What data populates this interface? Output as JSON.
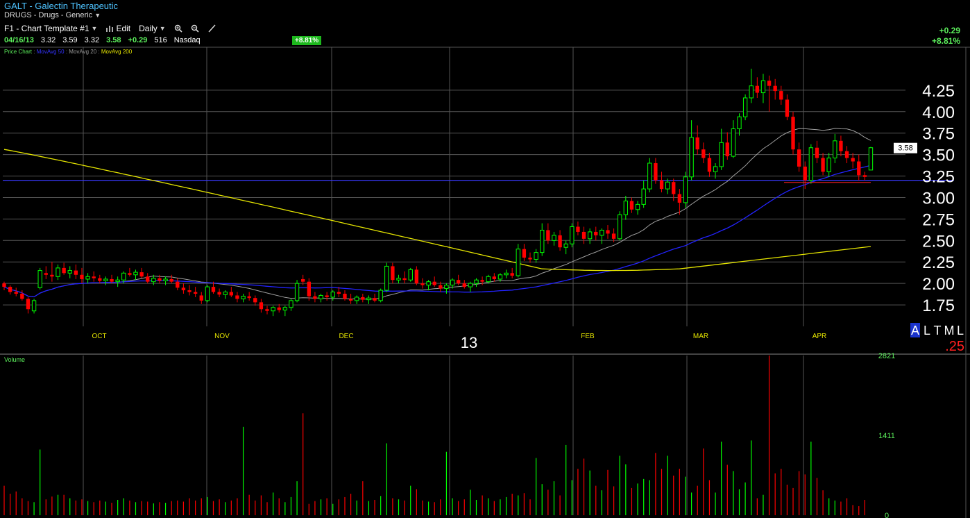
{
  "header": {
    "title": "GALT - Galectin Therapeutic",
    "subtitle": "DRUGS - Drugs - Generic",
    "template": "F1 - Chart Template #1",
    "edit": "Edit",
    "period": "Daily"
  },
  "quote": {
    "date": "04/16/13",
    "open": "3.32",
    "high": "3.59",
    "low": "3.32",
    "last": "3.58",
    "change": "+0.29",
    "volume": "516",
    "exchange": "Nasdaq",
    "pct_box": "+8.81%",
    "right_change": "+0.29",
    "right_pct": "+8.81%"
  },
  "legend": {
    "price": "Price Chart",
    "ma50": "MovAvg 50",
    "ma20": "MovAvg 20",
    "ma200": "MovAvg 200",
    "sep": ":"
  },
  "side": {
    "alm": [
      "A",
      "L",
      "T",
      "M",
      "L"
    ],
    "tick": ".25",
    "price_tag": "3.58"
  },
  "colors": {
    "up": "#00ff00",
    "down": "#ff0000",
    "ma20": "#a0a0a0",
    "ma50": "#2323ff",
    "ma200": "#e6e600",
    "hline": "#3a3aff",
    "grid": "#555555"
  },
  "chart_data": [
    {
      "type": "candlestick",
      "title": "",
      "y_ticks": [
        1.75,
        2.0,
        2.25,
        2.5,
        2.75,
        3.0,
        3.25,
        3.5,
        3.75,
        4.0,
        4.25
      ],
      "y_tick_labels": [
        "1.75",
        "2.00",
        "2.25",
        "2.50",
        "2.75",
        "3.00",
        "3.25",
        "3.50",
        "3.75",
        "4.00",
        "4.25"
      ],
      "ylim": [
        1.5,
        4.75
      ],
      "x_labels": [
        "OCT",
        "NOV",
        "DEC",
        "13",
        "FEB",
        "MAR",
        "APR"
      ],
      "horizontal_line": 3.2,
      "last_price": 3.58,
      "grid": true,
      "ohlc": [
        [
          2.0,
          2.02,
          1.92,
          1.96
        ],
        [
          1.96,
          1.98,
          1.87,
          1.9
        ],
        [
          1.9,
          1.95,
          1.85,
          1.88
        ],
        [
          1.88,
          1.92,
          1.8,
          1.82
        ],
        [
          1.82,
          1.84,
          1.65,
          1.7
        ],
        [
          1.68,
          1.82,
          1.65,
          1.8
        ],
        [
          1.95,
          2.18,
          1.93,
          2.15
        ],
        [
          2.12,
          2.2,
          2.05,
          2.1
        ],
        [
          2.1,
          2.25,
          2.02,
          2.08
        ],
        [
          2.08,
          2.22,
          2.04,
          2.18
        ],
        [
          2.18,
          2.24,
          2.1,
          2.12
        ],
        [
          2.12,
          2.2,
          2.06,
          2.15
        ],
        [
          2.15,
          2.22,
          2.05,
          2.1
        ],
        [
          2.1,
          2.18,
          2.0,
          2.05
        ],
        [
          2.05,
          2.12,
          2.0,
          2.08
        ],
        [
          2.08,
          2.14,
          2.02,
          2.06
        ],
        [
          2.06,
          2.1,
          2.0,
          2.03
        ],
        [
          2.03,
          2.08,
          1.98,
          2.05
        ],
        [
          2.05,
          2.1,
          2.0,
          2.02
        ],
        [
          2.02,
          2.08,
          1.96,
          2.04
        ],
        [
          2.04,
          2.14,
          2.0,
          2.12
        ],
        [
          2.12,
          2.18,
          2.08,
          2.1
        ],
        [
          2.1,
          2.16,
          2.04,
          2.13
        ],
        [
          2.13,
          2.18,
          2.06,
          2.08
        ],
        [
          2.08,
          2.12,
          2.0,
          2.02
        ],
        [
          2.02,
          2.1,
          1.98,
          2.06
        ],
        [
          2.06,
          2.1,
          2.0,
          2.03
        ],
        [
          2.03,
          2.08,
          1.98,
          2.05
        ],
        [
          2.05,
          2.1,
          2.0,
          2.02
        ],
        [
          2.02,
          2.06,
          1.92,
          1.95
        ],
        [
          1.95,
          2.0,
          1.88,
          1.92
        ],
        [
          1.92,
          1.98,
          1.86,
          1.9
        ],
        [
          1.9,
          1.96,
          1.84,
          1.88
        ],
        [
          1.86,
          1.9,
          1.76,
          1.8
        ],
        [
          1.8,
          1.98,
          1.78,
          1.96
        ],
        [
          1.96,
          2.02,
          1.88,
          1.9
        ],
        [
          1.9,
          1.94,
          1.84,
          1.87
        ],
        [
          1.87,
          1.92,
          1.82,
          1.9
        ],
        [
          1.9,
          1.96,
          1.84,
          1.86
        ],
        [
          1.86,
          1.9,
          1.78,
          1.82
        ],
        [
          1.82,
          1.88,
          1.78,
          1.85
        ],
        [
          1.85,
          1.9,
          1.8,
          1.83
        ],
        [
          1.83,
          1.86,
          1.74,
          1.78
        ],
        [
          1.78,
          1.82,
          1.66,
          1.7
        ],
        [
          1.7,
          1.74,
          1.64,
          1.68
        ],
        [
          1.68,
          1.74,
          1.62,
          1.72
        ],
        [
          1.72,
          1.76,
          1.66,
          1.69
        ],
        [
          1.69,
          1.74,
          1.62,
          1.72
        ],
        [
          1.72,
          1.82,
          1.68,
          1.8
        ],
        [
          1.8,
          2.04,
          1.78,
          2.0
        ],
        [
          2.05,
          2.1,
          1.98,
          2.02
        ],
        [
          2.02,
          2.06,
          1.8,
          1.85
        ],
        [
          1.85,
          1.9,
          1.78,
          1.82
        ],
        [
          1.82,
          1.88,
          1.78,
          1.86
        ],
        [
          1.86,
          1.9,
          1.8,
          1.84
        ],
        [
          1.84,
          1.92,
          1.8,
          1.9
        ],
        [
          1.9,
          1.96,
          1.84,
          1.88
        ],
        [
          1.88,
          1.92,
          1.8,
          1.82
        ],
        [
          1.82,
          1.88,
          1.76,
          1.8
        ],
        [
          1.8,
          1.86,
          1.76,
          1.84
        ],
        [
          1.84,
          1.88,
          1.78,
          1.81
        ],
        [
          1.81,
          1.86,
          1.76,
          1.83
        ],
        [
          1.83,
          1.88,
          1.78,
          1.8
        ],
        [
          1.8,
          1.94,
          1.78,
          1.92
        ],
        [
          1.92,
          2.24,
          1.9,
          2.2
        ],
        [
          2.2,
          2.24,
          2.0,
          2.04
        ],
        [
          2.04,
          2.1,
          2.0,
          2.06
        ],
        [
          2.06,
          2.14,
          2.0,
          2.04
        ],
        [
          2.04,
          2.18,
          2.02,
          2.16
        ],
        [
          2.16,
          2.2,
          1.98,
          2.0
        ],
        [
          2.0,
          2.06,
          1.94,
          1.98
        ],
        [
          1.98,
          2.04,
          1.92,
          2.02
        ],
        [
          2.02,
          2.08,
          1.96,
          1.98
        ],
        [
          1.98,
          2.02,
          1.9,
          1.94
        ],
        [
          1.94,
          2.0,
          1.88,
          1.98
        ],
        [
          1.98,
          2.06,
          1.94,
          2.04
        ],
        [
          2.04,
          2.1,
          1.98,
          2.0
        ],
        [
          2.0,
          2.04,
          1.94,
          1.96
        ],
        [
          1.96,
          2.02,
          1.9,
          2.0
        ],
        [
          2.0,
          2.06,
          1.96,
          2.04
        ],
        [
          2.04,
          2.08,
          1.98,
          2.02
        ],
        [
          2.02,
          2.1,
          2.0,
          2.08
        ],
        [
          2.08,
          2.12,
          2.02,
          2.05
        ],
        [
          2.05,
          2.12,
          2.02,
          2.1
        ],
        [
          2.1,
          2.16,
          2.06,
          2.12
        ],
        [
          2.12,
          2.18,
          2.06,
          2.09
        ],
        [
          2.09,
          2.46,
          2.07,
          2.4
        ],
        [
          2.4,
          2.46,
          2.26,
          2.3
        ],
        [
          2.3,
          2.36,
          2.24,
          2.28
        ],
        [
          2.28,
          2.4,
          2.24,
          2.36
        ],
        [
          2.36,
          2.7,
          2.32,
          2.62
        ],
        [
          2.62,
          2.7,
          2.46,
          2.5
        ],
        [
          2.5,
          2.6,
          2.44,
          2.56
        ],
        [
          2.56,
          2.62,
          2.38,
          2.42
        ],
        [
          2.42,
          2.5,
          2.34,
          2.46
        ],
        [
          2.46,
          2.7,
          2.42,
          2.66
        ],
        [
          2.66,
          2.72,
          2.56,
          2.6
        ],
        [
          2.6,
          2.66,
          2.46,
          2.52
        ],
        [
          2.52,
          2.64,
          2.46,
          2.6
        ],
        [
          2.6,
          2.66,
          2.5,
          2.56
        ],
        [
          2.56,
          2.64,
          2.46,
          2.62
        ],
        [
          2.62,
          2.68,
          2.52,
          2.58
        ],
        [
          2.58,
          2.64,
          2.48,
          2.52
        ],
        [
          2.52,
          2.84,
          2.5,
          2.8
        ],
        [
          2.8,
          3.02,
          2.74,
          2.96
        ],
        [
          2.96,
          3.0,
          2.82,
          2.86
        ],
        [
          2.86,
          2.96,
          2.8,
          2.92
        ],
        [
          2.92,
          3.2,
          2.88,
          3.1
        ],
        [
          3.1,
          3.46,
          3.06,
          3.4
        ],
        [
          3.4,
          3.46,
          3.16,
          3.2
        ],
        [
          3.2,
          3.3,
          3.06,
          3.1
        ],
        [
          3.1,
          3.22,
          3.04,
          3.18
        ],
        [
          3.18,
          3.22,
          2.96,
          3.04
        ],
        [
          3.04,
          3.1,
          2.8,
          2.94
        ],
        [
          2.94,
          3.3,
          2.88,
          3.24
        ],
        [
          3.24,
          3.9,
          3.2,
          3.7
        ],
        [
          3.7,
          3.84,
          3.5,
          3.56
        ],
        [
          3.56,
          3.64,
          3.4,
          3.46
        ],
        [
          3.46,
          3.52,
          3.24,
          3.3
        ],
        [
          3.3,
          3.4,
          3.22,
          3.36
        ],
        [
          3.36,
          3.8,
          3.32,
          3.64
        ],
        [
          3.64,
          3.76,
          3.44,
          3.48
        ],
        [
          3.48,
          3.9,
          3.46,
          3.8
        ],
        [
          3.8,
          3.98,
          3.72,
          3.94
        ],
        [
          3.94,
          4.2,
          3.9,
          4.16
        ],
        [
          4.16,
          4.5,
          4.1,
          4.3
        ],
        [
          4.3,
          4.4,
          4.16,
          4.22
        ],
        [
          4.22,
          4.44,
          4.1,
          4.36
        ],
        [
          4.36,
          4.42,
          4.0,
          4.3
        ],
        [
          4.3,
          4.38,
          4.14,
          4.24
        ],
        [
          4.24,
          4.3,
          4.08,
          4.14
        ],
        [
          4.14,
          4.2,
          3.9,
          3.94
        ],
        [
          3.94,
          4.0,
          3.5,
          3.56
        ],
        [
          3.56,
          3.64,
          3.3,
          3.36
        ],
        [
          3.36,
          3.42,
          3.1,
          3.2
        ],
        [
          3.2,
          3.62,
          3.16,
          3.58
        ],
        [
          3.58,
          3.66,
          3.4,
          3.46
        ],
        [
          3.46,
          3.52,
          3.26,
          3.3
        ],
        [
          3.3,
          3.52,
          3.24,
          3.46
        ],
        [
          3.46,
          3.74,
          3.4,
          3.66
        ],
        [
          3.66,
          3.72,
          3.48,
          3.54
        ],
        [
          3.54,
          3.6,
          3.4,
          3.46
        ],
        [
          3.46,
          3.52,
          3.34,
          3.42
        ],
        [
          3.42,
          3.5,
          3.2,
          3.26
        ],
        [
          3.26,
          3.3,
          3.2,
          3.24
        ],
        [
          3.32,
          3.59,
          3.32,
          3.58
        ]
      ]
    },
    {
      "type": "bar",
      "title": "Volume",
      "y_ticks": [
        0,
        1411,
        2821
      ],
      "ylim": [
        0,
        2821
      ],
      "values": [
        520,
        380,
        420,
        300,
        250,
        230,
        1160,
        280,
        330,
        360,
        360,
        300,
        260,
        280,
        250,
        230,
        260,
        240,
        220,
        270,
        300,
        260,
        230,
        250,
        240,
        210,
        230,
        220,
        250,
        260,
        240,
        300,
        260,
        300,
        320,
        250,
        280,
        230,
        260,
        300,
        1560,
        360,
        260,
        350,
        230,
        400,
        300,
        230,
        320,
        600,
        1800,
        200,
        250,
        280,
        300,
        200,
        280,
        320,
        380,
        260,
        600,
        250,
        270,
        340,
        1270,
        300,
        280,
        260,
        520,
        460,
        260,
        240,
        230,
        280,
        1120,
        300,
        250,
        280,
        450,
        270,
        350,
        300,
        250,
        280,
        320,
        380,
        350,
        390,
        280,
        1010,
        550,
        450,
        600,
        350,
        1240,
        620,
        820,
        1000,
        790,
        520,
        440,
        800,
        510,
        1050,
        900,
        480,
        560,
        640,
        620,
        1100,
        820,
        1050,
        700,
        820,
        680,
        400,
        520,
        1180,
        620,
        400,
        1300,
        890,
        780,
        460,
        580,
        1320,
        300,
        360,
        2821,
        740,
        820,
        540,
        480,
        780,
        720,
        1300,
        660,
        440,
        300,
        260,
        240,
        300,
        180,
        160,
        270
      ]
    }
  ]
}
